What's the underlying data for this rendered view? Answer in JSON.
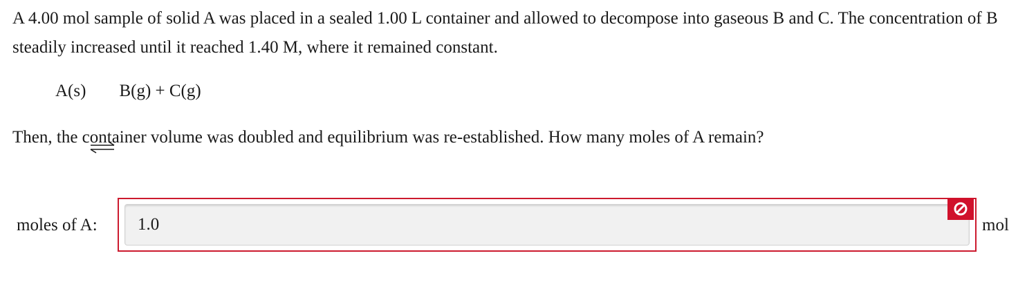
{
  "question": {
    "paragraph1": "A 4.00 mol sample of solid A was placed in a sealed 1.00 L container and allowed to decompose into gaseous B and C. The concentration of B steadily increased until it reached 1.40 M, where it remained constant.",
    "equation": {
      "left": "A(s)",
      "right_b": "B(g)",
      "plus": "+",
      "right_c": "C(g)"
    },
    "paragraph2": "Then, the container volume was doubled and equilibrium was re-established. How many moles of A remain?"
  },
  "answer": {
    "label": "moles of A:",
    "value": "1.0",
    "unit": "mol",
    "status": "incorrect",
    "status_icon": "prohibited-icon",
    "error_color": "#d0112b"
  }
}
